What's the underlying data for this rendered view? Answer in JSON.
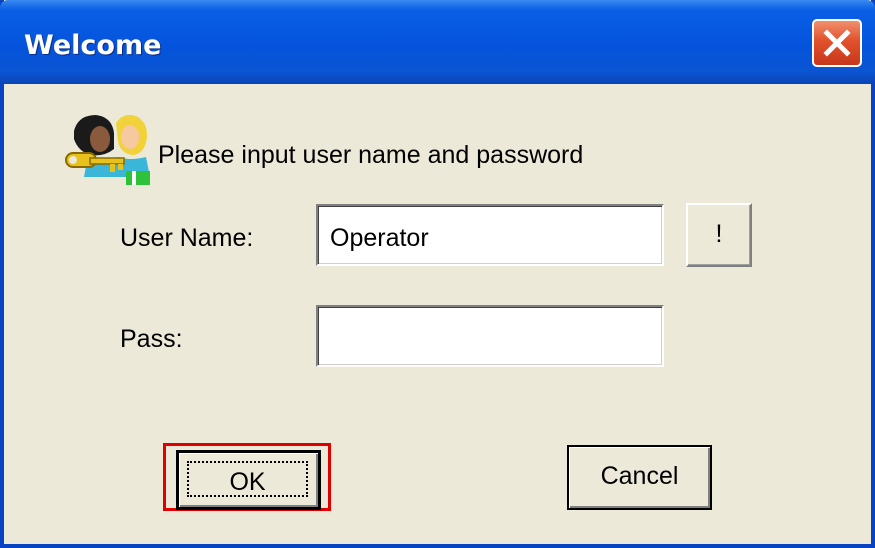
{
  "window": {
    "title": "Welcome",
    "close_icon": "close-x-icon"
  },
  "dialog": {
    "icon": "users-key-icon",
    "prompt": "Please input user name and password",
    "user_name_label": "User Name:",
    "user_name_value": "Operator",
    "bang_button_label": "!",
    "pass_label": "Pass:",
    "pass_value": "",
    "ok_label": "OK",
    "cancel_label": "Cancel"
  },
  "colors": {
    "titlebar": "#0553DC",
    "face": "#ECE9D8",
    "highlight": "#E00000"
  }
}
